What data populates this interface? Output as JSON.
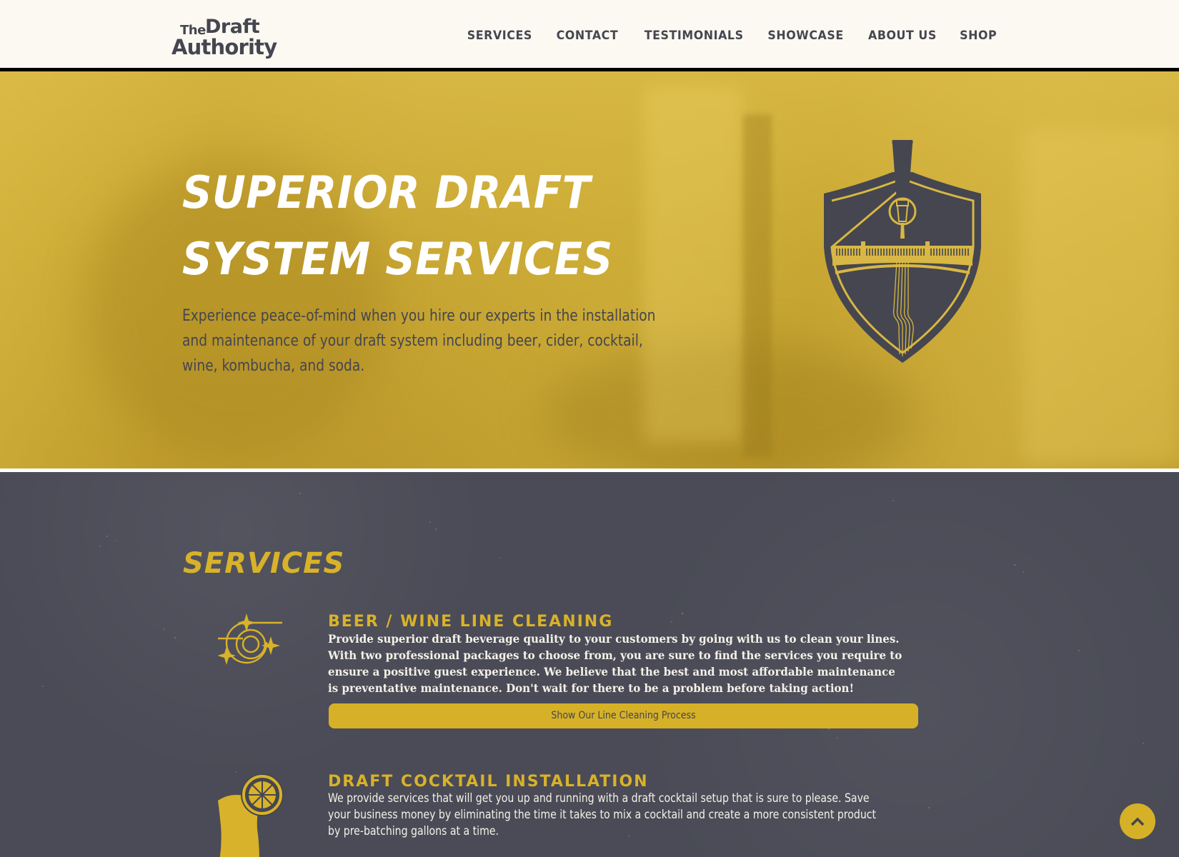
{
  "header": {
    "logo": {
      "line1_small": "The",
      "line1_large": "Draft",
      "line2": "Authority"
    },
    "nav": [
      {
        "label": "SERVICES"
      },
      {
        "label": "CONTACT"
      },
      {
        "label": "TESTIMONIALS"
      },
      {
        "label": "SHOWCASE"
      },
      {
        "label": "ABOUT US"
      },
      {
        "label": "SHOP"
      }
    ]
  },
  "hero": {
    "title_line1": "SUPERIOR DRAFT",
    "title_line2": "SYSTEM SERVICES",
    "description": "Experience peace-of-mind when you hire our experts in the installation and maintenance of your draft system including beer, cider, cocktail, wine, kombucha, and soda.",
    "emblem_icon": "shield-tap-bridge-emblem"
  },
  "services": {
    "heading": "SERVICES",
    "items": [
      {
        "icon": "sparkling-line-coil-icon",
        "title": "BEER / WINE LINE CLEANING",
        "text": "Provide superior draft beverage quality to your customers by going with us to clean your lines. With two professional packages to choose from, you are sure to find the services you require to ensure a positive guest experience. We believe that the best and most affordable maintenance is preventative maintenance. Don't wait for there to be a problem before taking action!",
        "button_label": "Show Our Line Cleaning Process"
      },
      {
        "icon": "cocktail-glass-citrus-icon",
        "title": "DRAFT COCKTAIL INSTALLATION",
        "text": "We provide services that will get you up and running with a draft cocktail setup that is sure to please. Save your business money by eliminating the time it takes to mix a cocktail and create a more consistent product by pre-batching gallons at a time."
      }
    ]
  },
  "scroll_top": {
    "icon": "chevron-up-icon"
  },
  "colors": {
    "header_bg": "#fbf9f2",
    "text_dark": "#45464f",
    "hero_yellow": "#cfad38",
    "accent_gold": "#d6b128",
    "section_dark": "#4a4b56",
    "white": "#ffffff"
  }
}
